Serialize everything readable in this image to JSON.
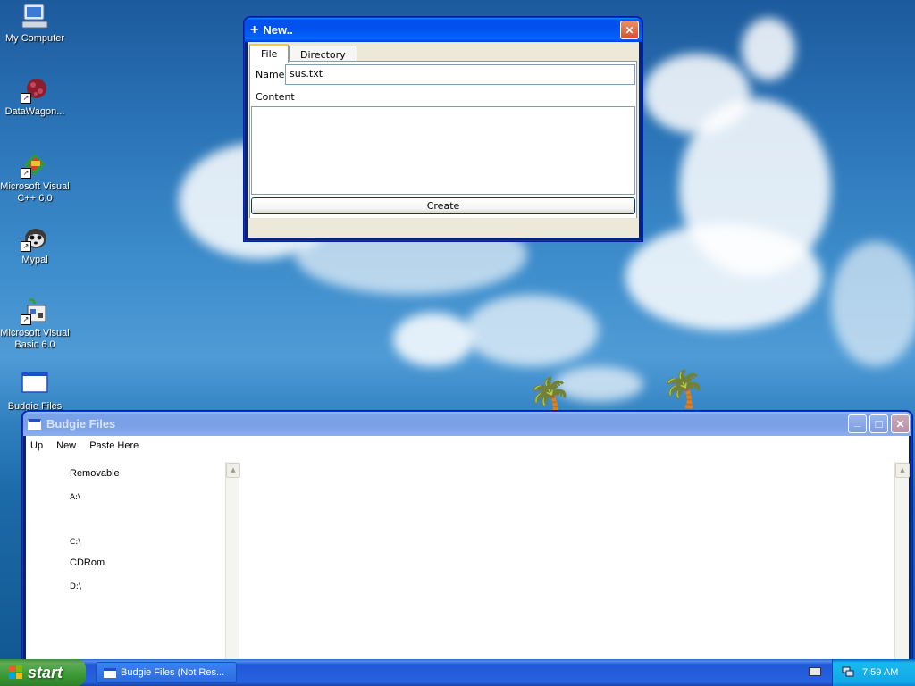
{
  "desktop": {
    "icons": [
      {
        "label": "My Computer",
        "icon": "my-computer-icon"
      },
      {
        "label": "DataWagon...",
        "icon": "datawagon-icon"
      },
      {
        "label": "Microsoft Visual C++ 6.0",
        "icon": "visual-cpp-icon"
      },
      {
        "label": "Mypal",
        "icon": "mypal-icon"
      },
      {
        "label": "Microsoft Visual Basic 6.0",
        "icon": "visual-basic-icon"
      },
      {
        "label": "Budgie Files",
        "icon": "budgie-files-icon"
      }
    ]
  },
  "new_dialog": {
    "title": "New..",
    "title_icon": "+",
    "close_glyph": "✕",
    "tabs": [
      "File",
      "Directory"
    ],
    "name_label": "Name",
    "name_value": "sus.txt",
    "content_label": "Content",
    "content_value": "",
    "create_label": "Create"
  },
  "budgie": {
    "title": "Budgie Files",
    "menu": [
      "Up",
      "New",
      "Paste Here"
    ],
    "drives": [
      {
        "text": "Removable",
        "kind": "group"
      },
      {
        "text": "A:\\",
        "kind": "drive"
      },
      {
        "text": "C:\\",
        "kind": "drive"
      },
      {
        "text": "CDRom",
        "kind": "group"
      },
      {
        "text": "D:\\",
        "kind": "drive"
      }
    ],
    "controls": {
      "minimize": "_",
      "maximize": "□",
      "close": "✕"
    }
  },
  "taskbar": {
    "start_label": "start",
    "task_label": "Budgie Files (Not Res...",
    "clock": "7:59 AM"
  },
  "colors": {
    "accent": "#0053ee",
    "start_green": "#3b9a35",
    "tray": "#13a7e8"
  }
}
